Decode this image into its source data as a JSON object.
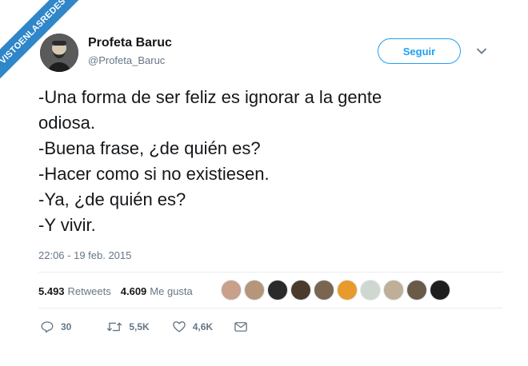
{
  "watermark": {
    "text": "VISTOENLASREDES"
  },
  "tweet": {
    "display_name": "Profeta Baruc",
    "handle": "@Profeta_Baruc",
    "follow_label": "Seguir",
    "lines": [
      "-Una forma de ser feliz es ignorar a la gente",
      "odiosa.",
      "-Buena frase, ¿de quién es?",
      "-Hacer como si no existiesen.",
      "-Ya, ¿de quién es?",
      "-Y vivir."
    ],
    "timestamp": "22:06 - 19 feb. 2015"
  },
  "stats": {
    "retweets_count": "5.493",
    "retweets_label": "Retweets",
    "likes_count": "4.609",
    "likes_label": "Me gusta"
  },
  "likers": [
    {
      "icon": "avatar-sunset",
      "color": "#c9a08a"
    },
    {
      "icon": "avatar-person",
      "color": "#b5967a"
    },
    {
      "icon": "avatar-person",
      "color": "#2a2a2a"
    },
    {
      "icon": "avatar-dark",
      "color": "#4a3b2c"
    },
    {
      "icon": "avatar-person",
      "color": "#7a6650"
    },
    {
      "icon": "avatar-logo-donoso",
      "color": "#e89a2c"
    },
    {
      "icon": "avatar-light",
      "color": "#cfd8d0"
    },
    {
      "icon": "avatar-person",
      "color": "#bfae98"
    },
    {
      "icon": "avatar-sunset",
      "color": "#6a5a48"
    },
    {
      "icon": "avatar-dark",
      "color": "#1e1e1e"
    }
  ],
  "actions": {
    "replies": "30",
    "retweets": "5,5K",
    "likes": "4,6K"
  },
  "colors": {
    "accent": "#1da1f2",
    "text": "#14171a",
    "muted": "#657786",
    "watermark": "#2f86c9"
  }
}
